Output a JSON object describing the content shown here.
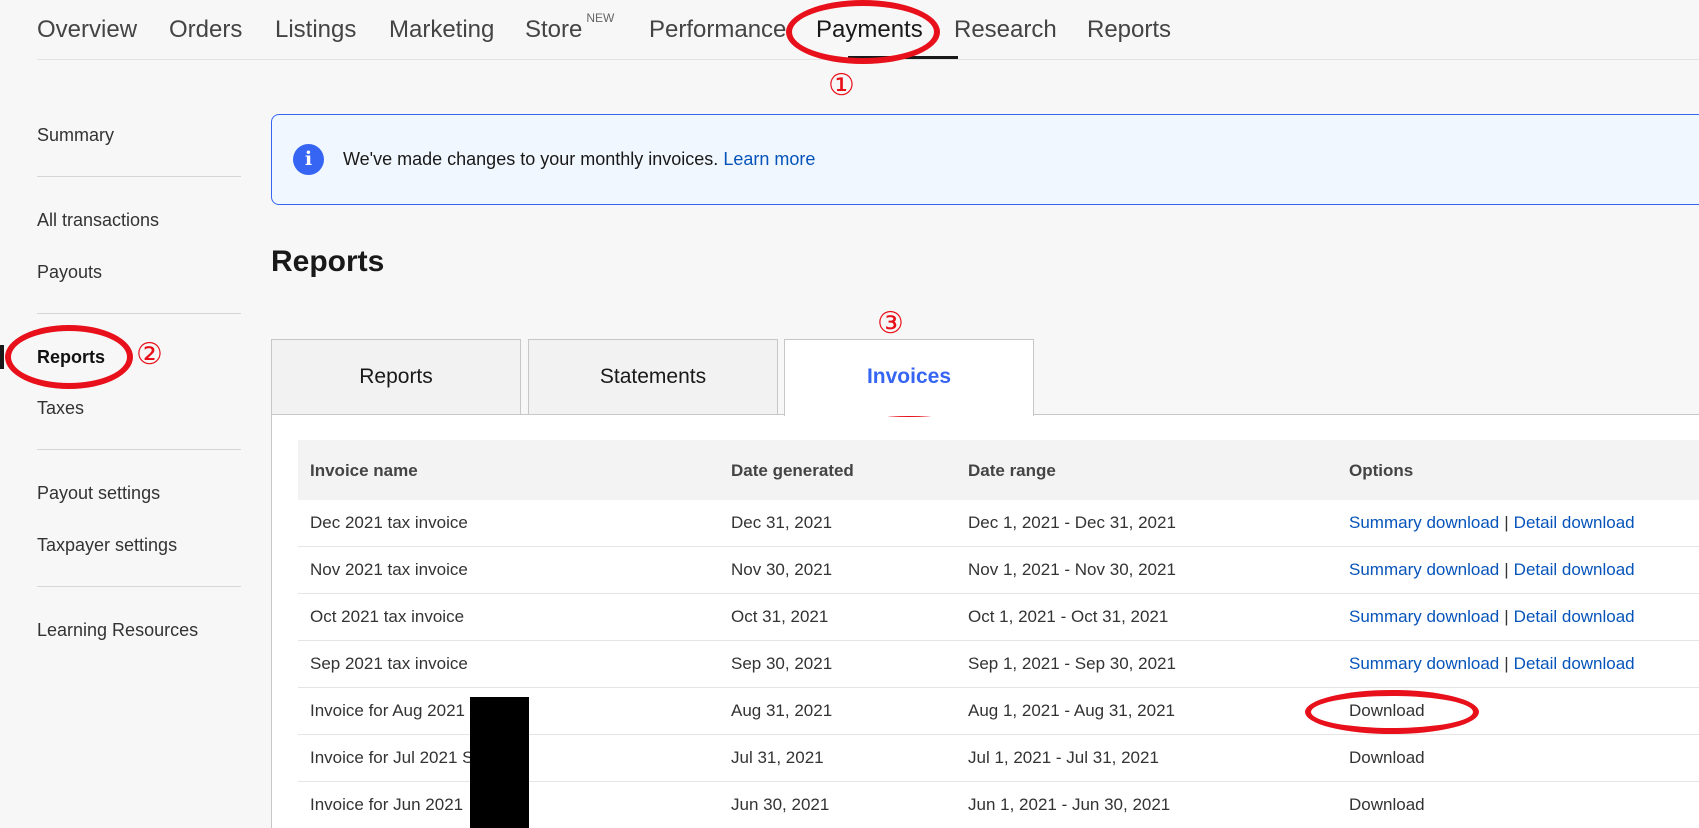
{
  "topnav": {
    "items": [
      "Overview",
      "Orders",
      "Listings",
      "Marketing",
      "Store",
      "Performance",
      "Payments",
      "Research",
      "Reports"
    ],
    "store_badge": "NEW"
  },
  "sidebar": {
    "items": [
      "Summary",
      "All transactions",
      "Payouts",
      "Reports",
      "Taxes",
      "Payout settings",
      "Taxpayer settings",
      "Learning Resources"
    ]
  },
  "banner": {
    "message": "We've made changes to your monthly invoices.",
    "link": "Learn more",
    "icon": "info-icon"
  },
  "page": {
    "title": "Reports"
  },
  "tabs": [
    "Reports",
    "Statements",
    "Invoices"
  ],
  "table": {
    "columns": [
      "Invoice name",
      "Date generated",
      "Date range",
      "Options"
    ],
    "rows": [
      {
        "name": "Dec 2021 tax invoice",
        "generated": "Dec 31, 2021",
        "range": "Dec 1, 2021 - Dec 31, 2021",
        "opt1": "Summary download",
        "sep": "|",
        "opt2": "Detail download"
      },
      {
        "name": "Nov 2021 tax invoice",
        "generated": "Nov 30, 2021",
        "range": "Nov 1, 2021 - Nov 30, 2021",
        "opt1": "Summary download",
        "sep": "|",
        "opt2": "Detail download"
      },
      {
        "name": "Oct 2021 tax invoice",
        "generated": "Oct 31, 2021",
        "range": "Oct 1, 2021 - Oct 31, 2021",
        "opt1": "Summary download",
        "sep": "|",
        "opt2": "Detail download"
      },
      {
        "name": "Sep 2021 tax invoice",
        "generated": "Sep 30, 2021",
        "range": "Sep 1, 2021 - Sep 30, 2021",
        "opt1": "Summary download",
        "sep": "|",
        "opt2": "Detail download"
      },
      {
        "name": "Invoice for Aug 2021",
        "generated": "Aug 31, 2021",
        "range": "Aug 1, 2021 - Aug 31, 2021",
        "opt1": "Download"
      },
      {
        "name": "Invoice for Jul 2021 S",
        "generated": "Jul 31, 2021",
        "range": "Jul 1, 2021 - Jul 31, 2021",
        "opt1": "Download"
      },
      {
        "name": "Invoice for Jun 2021",
        "generated": "Jun 30, 2021",
        "range": "Jun 1, 2021 - Jun 30, 2021",
        "opt1": "Download"
      }
    ]
  },
  "annotations": {
    "step1": "①",
    "step2": "②",
    "step3": "③",
    "color": "#e8101a"
  }
}
